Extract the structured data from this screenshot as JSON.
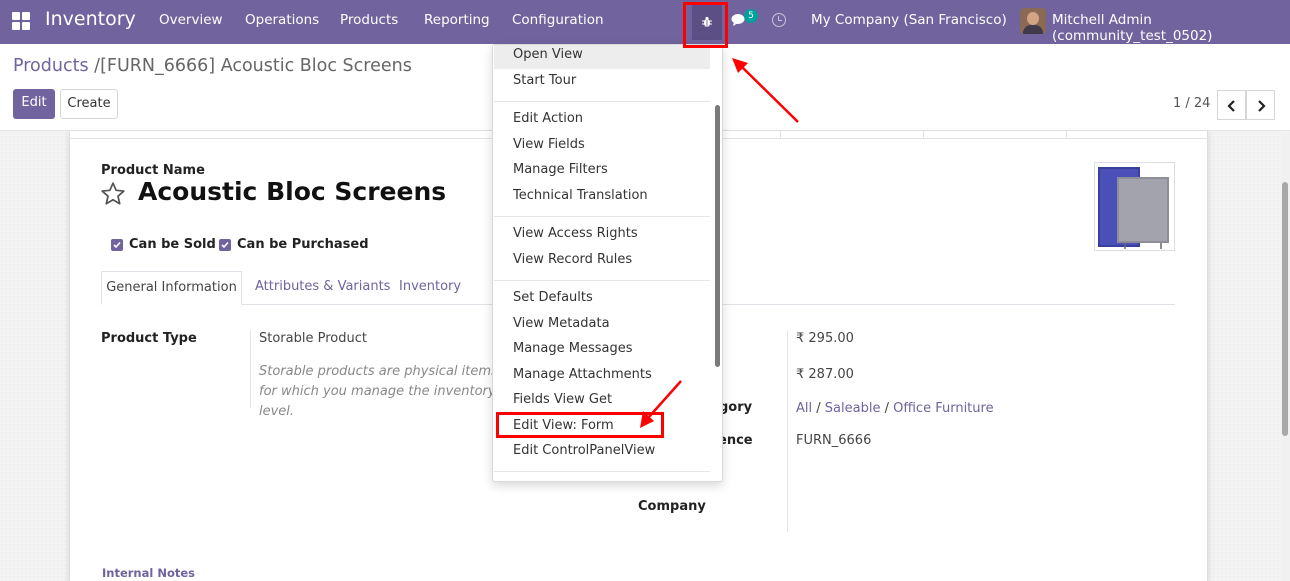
{
  "navbar": {
    "app_name": "Inventory",
    "menu": [
      "Overview",
      "Operations",
      "Products",
      "Reporting",
      "Configuration"
    ],
    "chat_count": "5",
    "company": "My Company (San Francisco)",
    "user": "Mitchell Admin (community_test_0502)"
  },
  "breadcrumb": {
    "parent": "Products",
    "separator": "/",
    "current": "[FURN_6666] Acoustic Bloc Screens"
  },
  "control_panel": {
    "edit_label": "Edit",
    "create_label": "Create",
    "pager": "1 / 24"
  },
  "form": {
    "name_label": "Product Name",
    "name": "Acoustic Bloc Screens",
    "can_be_sold": "Can be Sold",
    "can_be_purchased": "Can be Purchased",
    "tabs": [
      "General Information",
      "Attributes & Variants",
      "Inventory"
    ],
    "product_type_label": "Product Type",
    "product_type_value": "Storable Product",
    "product_type_help": "Storable products are physical items for which you manage the inventory level.",
    "sales_price": "₹ 295.00",
    "cost": "₹ 287.00",
    "category_label_partial": "gory",
    "category_path": [
      "All",
      "Saleable",
      "Office Furniture"
    ],
    "category_separator": "/",
    "reference_label_partial": "ence",
    "reference_value": "FURN_6666",
    "company_label": "Company",
    "internal_notes": "Internal Notes"
  },
  "debug_menu": {
    "groups": [
      [
        "Open View",
        "Start Tour"
      ],
      [
        "Edit Action",
        "View Fields",
        "Manage Filters",
        "Technical Translation"
      ],
      [
        "View Access Rights",
        "View Record Rules"
      ],
      [
        "Set Defaults",
        "View Metadata",
        "Manage Messages",
        "Manage Attachments",
        "Fields View Get",
        "Edit View: Form",
        "Edit ControlPanelView"
      ]
    ]
  },
  "colors": {
    "brand": "#71639e",
    "annotation": "#ff0000",
    "badge": "#00a09d"
  }
}
